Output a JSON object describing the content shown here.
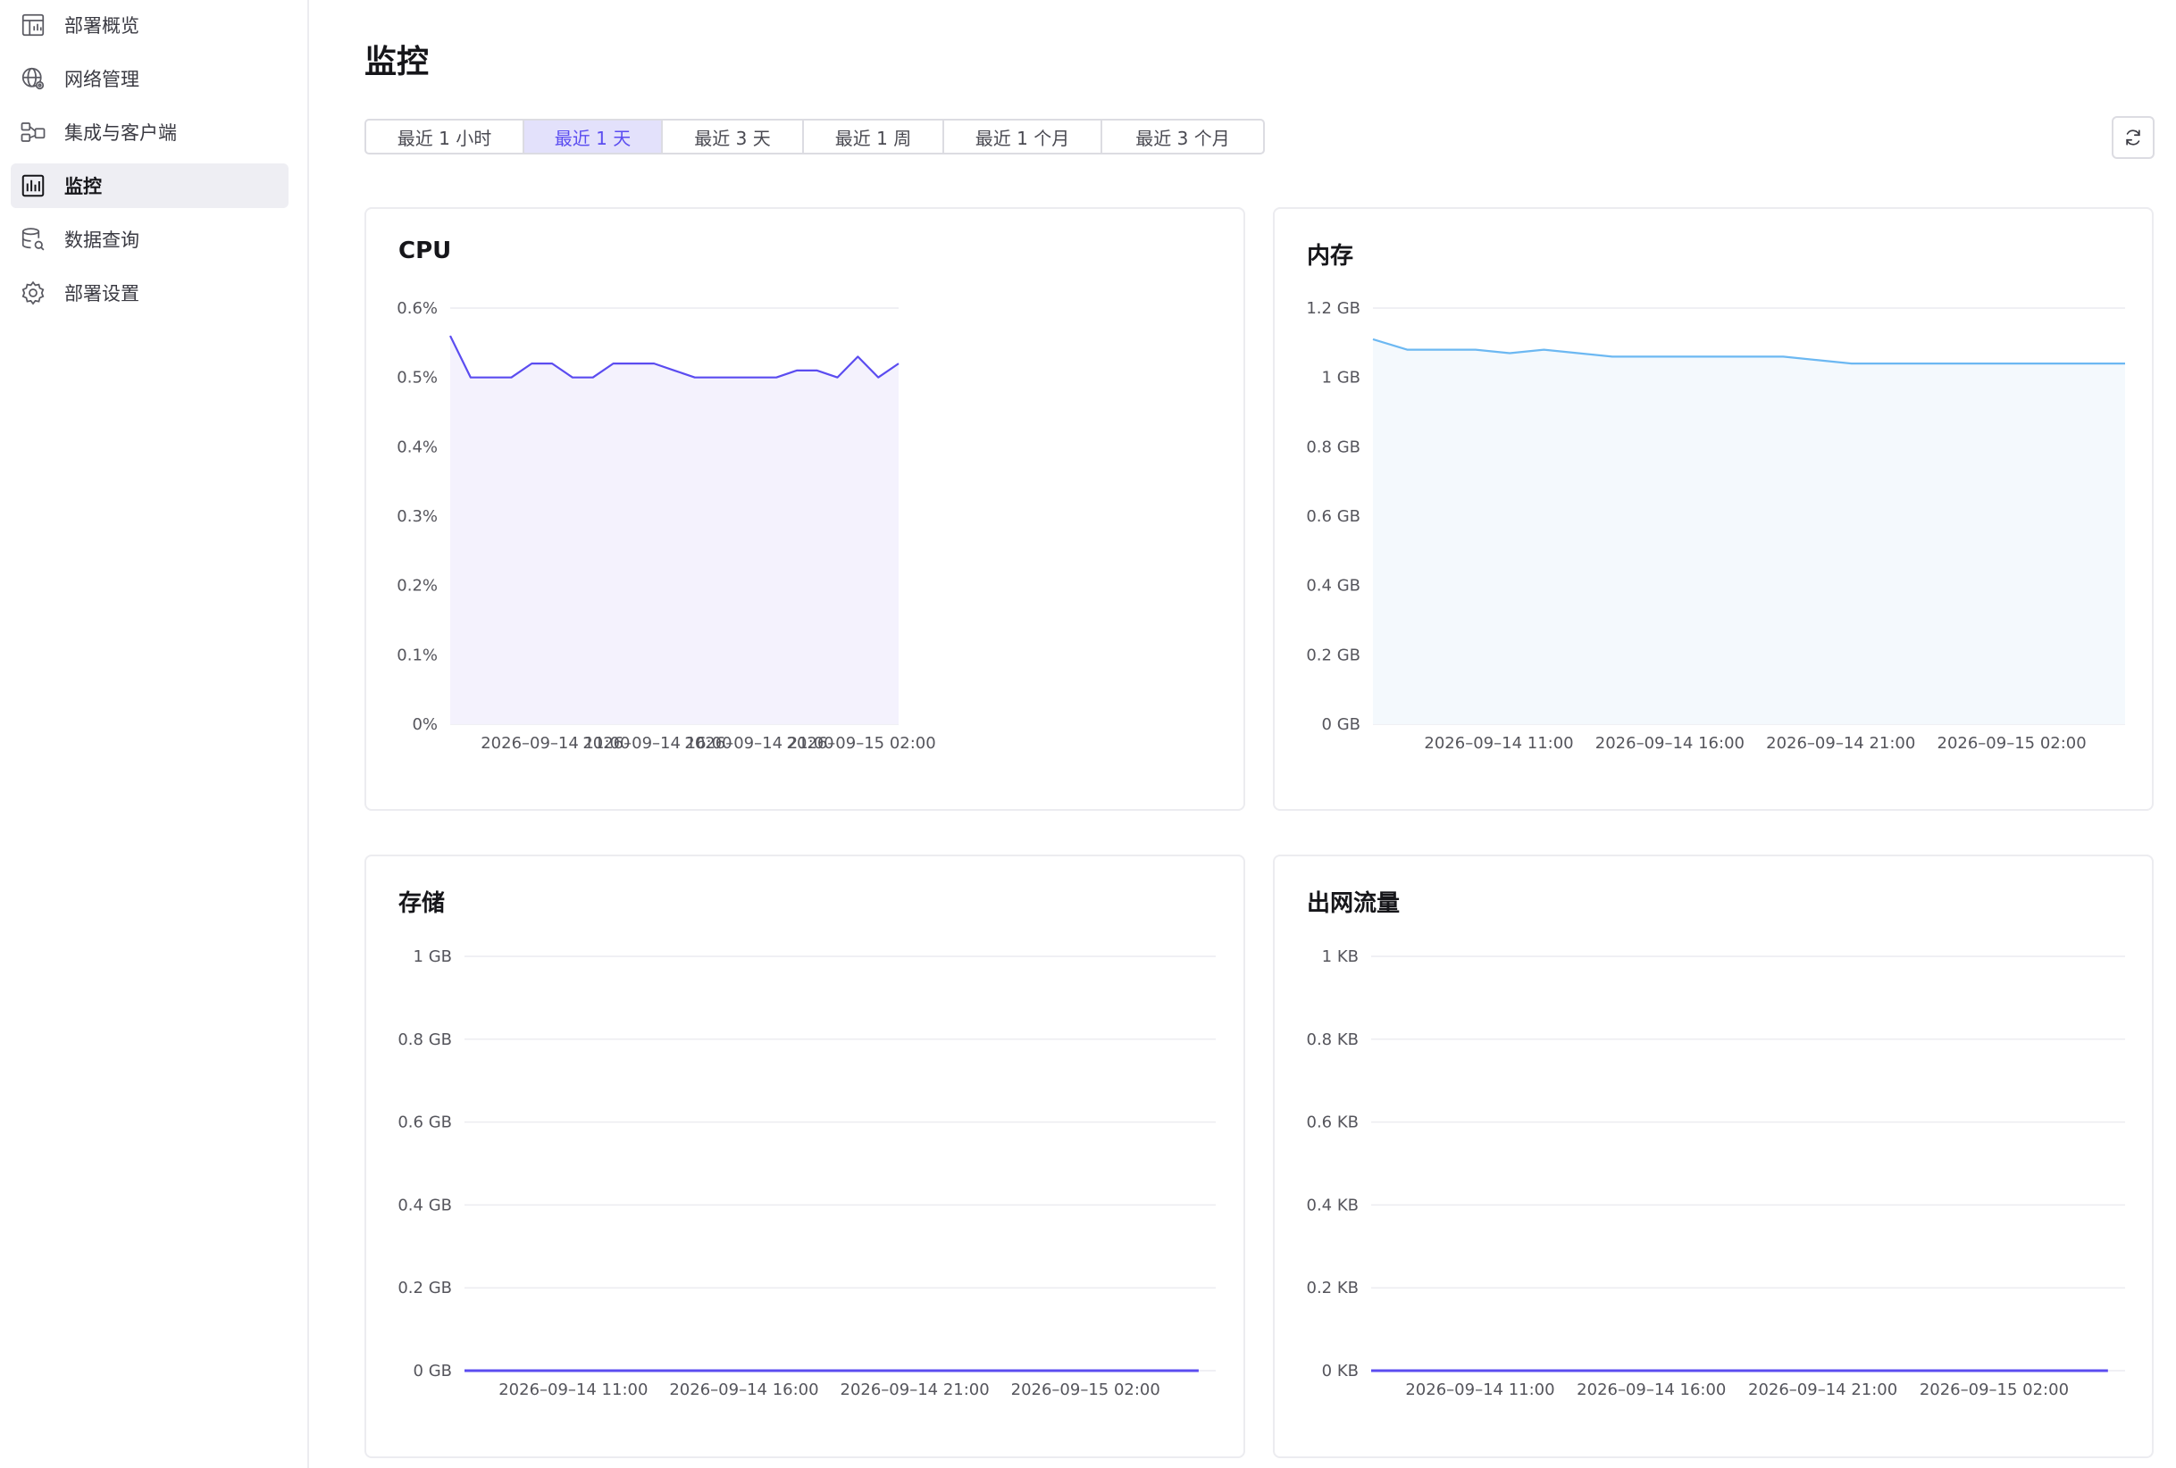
{
  "sidebar": {
    "items": [
      {
        "label": "部署概览",
        "icon": "dashboard-icon",
        "active": false
      },
      {
        "label": "网络管理",
        "icon": "globe-gear-icon",
        "active": false
      },
      {
        "label": "集成与客户端",
        "icon": "integration-icon",
        "active": false
      },
      {
        "label": "监控",
        "icon": "bar-chart-icon",
        "active": true
      },
      {
        "label": "数据查询",
        "icon": "database-search-icon",
        "active": false
      },
      {
        "label": "部署设置",
        "icon": "gear-icon",
        "active": false
      }
    ]
  },
  "page": {
    "title": "监控",
    "ranges": [
      "最近 1 小时",
      "最近 1 天",
      "最近 3 天",
      "最近 1 周",
      "最近 1 个月",
      "最近 3 个月"
    ],
    "active_range": 1,
    "refresh_icon": "refresh-icon"
  },
  "colors": {
    "accent": "#5b4df0",
    "cpu_line": "#5b4cf0",
    "cpu_fill": "#f4f2fd",
    "memory_line": "#6cb8f2",
    "memory_fill": "#f4f9fd",
    "grid": "#ececf0"
  },
  "chart_data": [
    {
      "id": "cpu",
      "type": "area",
      "title": "CPU",
      "x": [
        "2026-09-14 09:30",
        "2026-09-14 10:30",
        "2026-09-14 11:30",
        "2026-09-14 12:30",
        "2026-09-14 13:30",
        "2026-09-14 14:30",
        "2026-09-14 15:30",
        "2026-09-14 16:30",
        "2026-09-14 17:30",
        "2026-09-14 18:30",
        "2026-09-14 19:30",
        "2026-09-14 20:30",
        "2026-09-14 21:30",
        "2026-09-14 22:30",
        "2026-09-14 23:30",
        "2026-09-15 00:30",
        "2026-09-15 01:30",
        "2026-09-15 02:30",
        "2026-09-15 03:30",
        "2026-09-15 04:30",
        "2026-09-15 05:30",
        "2026-09-15 06:30",
        "2026-09-15 07:30"
      ],
      "values": [
        0.56,
        0.5,
        0.5,
        0.5,
        0.52,
        0.52,
        0.5,
        0.5,
        0.52,
        0.52,
        0.52,
        0.51,
        0.5,
        0.5,
        0.5,
        0.5,
        0.5,
        0.51,
        0.51,
        0.5,
        0.53,
        0.5,
        0.52
      ],
      "ylim": [
        0,
        0.6
      ],
      "yticks": [
        "0%",
        "0.1%",
        "0.2%",
        "0.3%",
        "0.4%",
        "0.5%",
        "0.6%"
      ],
      "xticks": [
        "2026-09-14 11:00",
        "2026-09-14 16:00",
        "2026-09-14 21:00",
        "2026-09-15 02:00"
      ],
      "xlim": [
        "2026-09-14 09:30",
        "2026-09-15 07:30"
      ],
      "grid": true
    },
    {
      "id": "memory",
      "type": "area",
      "title": "内存",
      "x": [
        "2026-09-14 09:30",
        "2026-09-14 10:30",
        "2026-09-14 11:30",
        "2026-09-14 12:30",
        "2026-09-14 13:30",
        "2026-09-14 14:30",
        "2026-09-14 15:30",
        "2026-09-14 16:30",
        "2026-09-14 17:30",
        "2026-09-14 18:30",
        "2026-09-14 19:30",
        "2026-09-14 20:30",
        "2026-09-14 21:30",
        "2026-09-14 22:30",
        "2026-09-14 23:30",
        "2026-09-15 00:30",
        "2026-09-15 01:30",
        "2026-09-15 02:30",
        "2026-09-15 03:30",
        "2026-09-15 04:30",
        "2026-09-15 05:30",
        "2026-09-15 06:30",
        "2026-09-15 07:30"
      ],
      "values": [
        1.11,
        1.08,
        1.08,
        1.08,
        1.07,
        1.08,
        1.07,
        1.06,
        1.06,
        1.06,
        1.06,
        1.06,
        1.06,
        1.05,
        1.04,
        1.04,
        1.04,
        1.04,
        1.04,
        1.04,
        1.04,
        1.04,
        1.04
      ],
      "ylim": [
        0,
        1.2
      ],
      "yticks": [
        "0 GB",
        "0.2 GB",
        "0.4 GB",
        "0.6 GB",
        "0.8 GB",
        "1 GB",
        "1.2 GB"
      ],
      "xticks": [
        "2026-09-14 11:00",
        "2026-09-14 16:00",
        "2026-09-14 21:00",
        "2026-09-15 02:00"
      ],
      "xlim": [
        "2026-09-14 09:30",
        "2026-09-15 07:30"
      ],
      "grid": true
    },
    {
      "id": "storage",
      "type": "line",
      "title": "存储",
      "x": [
        "2026-09-14 10:00",
        "2026-09-15 07:30"
      ],
      "values": [
        0,
        0
      ],
      "ylim": [
        0,
        1
      ],
      "yticks": [
        "0 GB",
        "0.2 GB",
        "0.4 GB",
        "0.6 GB",
        "0.8 GB",
        "1 GB"
      ],
      "xticks": [
        "2026-09-14 11:00",
        "2026-09-14 16:00",
        "2026-09-14 21:00",
        "2026-09-15 02:00"
      ],
      "xlim": [
        "2026-09-14 10:00",
        "2026-09-15 08:00"
      ],
      "grid": true
    },
    {
      "id": "egress",
      "type": "line",
      "title": "出网流量",
      "x": [
        "2026-09-14 10:00",
        "2026-09-15 07:30"
      ],
      "values": [
        0,
        0
      ],
      "ylim": [
        0,
        1
      ],
      "yticks": [
        "0 KB",
        "0.2 KB",
        "0.4 KB",
        "0.6 KB",
        "0.8 KB",
        "1 KB"
      ],
      "xticks": [
        "2026-09-14 11:00",
        "2026-09-14 16:00",
        "2026-09-14 21:00",
        "2026-09-15 02:00"
      ],
      "xlim": [
        "2026-09-14 10:00",
        "2026-09-15 08:00"
      ],
      "grid": true
    }
  ]
}
